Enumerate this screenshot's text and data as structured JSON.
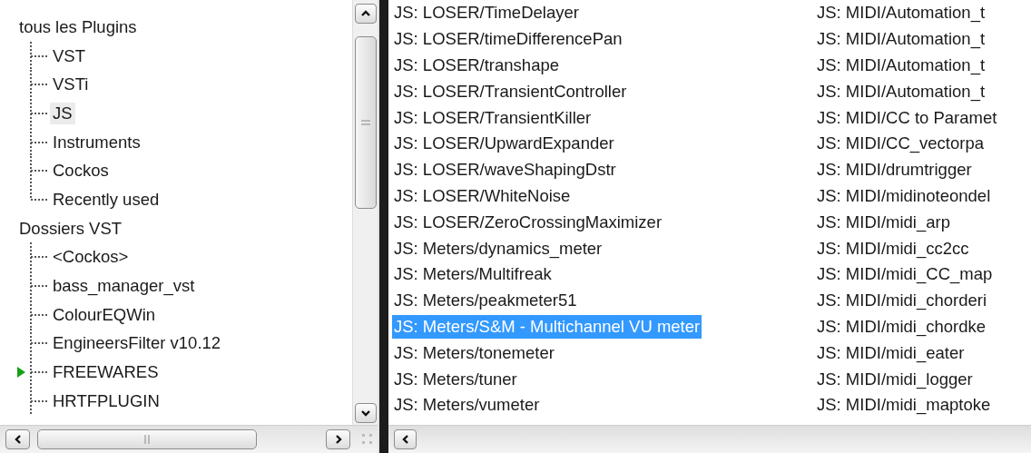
{
  "tree": {
    "items": [
      {
        "label": "tous les Plugins",
        "selected": false,
        "expander": false,
        "children": [
          {
            "label": "VST",
            "selected": false,
            "expander": false
          },
          {
            "label": "VSTi",
            "selected": false,
            "expander": false
          },
          {
            "label": "JS",
            "selected": true,
            "expander": false
          },
          {
            "label": "Instruments",
            "selected": false,
            "expander": false
          },
          {
            "label": "Cockos",
            "selected": false,
            "expander": false
          },
          {
            "label": "Recently used",
            "selected": false,
            "expander": false
          }
        ]
      },
      {
        "label": "Dossiers VST",
        "selected": false,
        "expander": false,
        "children": [
          {
            "label": "<Cockos>",
            "selected": false,
            "expander": false
          },
          {
            "label": "bass_manager_vst",
            "selected": false,
            "expander": false
          },
          {
            "label": "ColourEQWin",
            "selected": false,
            "expander": false
          },
          {
            "label": "EngineersFilter v10.12",
            "selected": false,
            "expander": false
          },
          {
            "label": "FREEWARES",
            "selected": false,
            "expander": true
          },
          {
            "label": "HRTFPLUGIN",
            "selected": false,
            "expander": false
          }
        ]
      }
    ]
  },
  "plugin_list": {
    "columns": [
      {
        "items": [
          {
            "label": "JS: LOSER/TimeDelayer",
            "selected": false
          },
          {
            "label": "JS: LOSER/timeDifferencePan",
            "selected": false
          },
          {
            "label": "JS: LOSER/transhape",
            "selected": false
          },
          {
            "label": "JS: LOSER/TransientController",
            "selected": false
          },
          {
            "label": "JS: LOSER/TransientKiller",
            "selected": false
          },
          {
            "label": "JS: LOSER/UpwardExpander",
            "selected": false
          },
          {
            "label": "JS: LOSER/waveShapingDstr",
            "selected": false
          },
          {
            "label": "JS: LOSER/WhiteNoise",
            "selected": false
          },
          {
            "label": "JS: LOSER/ZeroCrossingMaximizer",
            "selected": false
          },
          {
            "label": "JS: Meters/dynamics_meter",
            "selected": false
          },
          {
            "label": "JS: Meters/Multifreak",
            "selected": false
          },
          {
            "label": "JS: Meters/peakmeter51",
            "selected": false
          },
          {
            "label": "JS: Meters/S&M - Multichannel VU meter",
            "selected": true
          },
          {
            "label": "JS: Meters/tonemeter",
            "selected": false
          },
          {
            "label": "JS: Meters/tuner",
            "selected": false
          },
          {
            "label": "JS: Meters/vumeter",
            "selected": false
          }
        ]
      },
      {
        "items": [
          {
            "label": "JS: MIDI/Automation_t",
            "selected": false
          },
          {
            "label": "JS: MIDI/Automation_t",
            "selected": false
          },
          {
            "label": "JS: MIDI/Automation_t",
            "selected": false
          },
          {
            "label": "JS: MIDI/Automation_t",
            "selected": false
          },
          {
            "label": "JS: MIDI/CC to Paramet",
            "selected": false
          },
          {
            "label": "JS: MIDI/CC_vectorpa",
            "selected": false
          },
          {
            "label": "JS: MIDI/drumtrigger",
            "selected": false
          },
          {
            "label": "JS: MIDI/midinoteondel",
            "selected": false
          },
          {
            "label": "JS: MIDI/midi_arp",
            "selected": false
          },
          {
            "label": "JS: MIDI/midi_cc2cc",
            "selected": false
          },
          {
            "label": "JS: MIDI/midi_CC_map",
            "selected": false
          },
          {
            "label": "JS: MIDI/midi_chorderi",
            "selected": false
          },
          {
            "label": "JS: MIDI/midi_chordke",
            "selected": false
          },
          {
            "label": "JS: MIDI/midi_eater",
            "selected": false
          },
          {
            "label": "JS: MIDI/midi_logger",
            "selected": false
          },
          {
            "label": "JS: MIDI/midi_maptoke",
            "selected": false
          }
        ]
      }
    ]
  }
}
